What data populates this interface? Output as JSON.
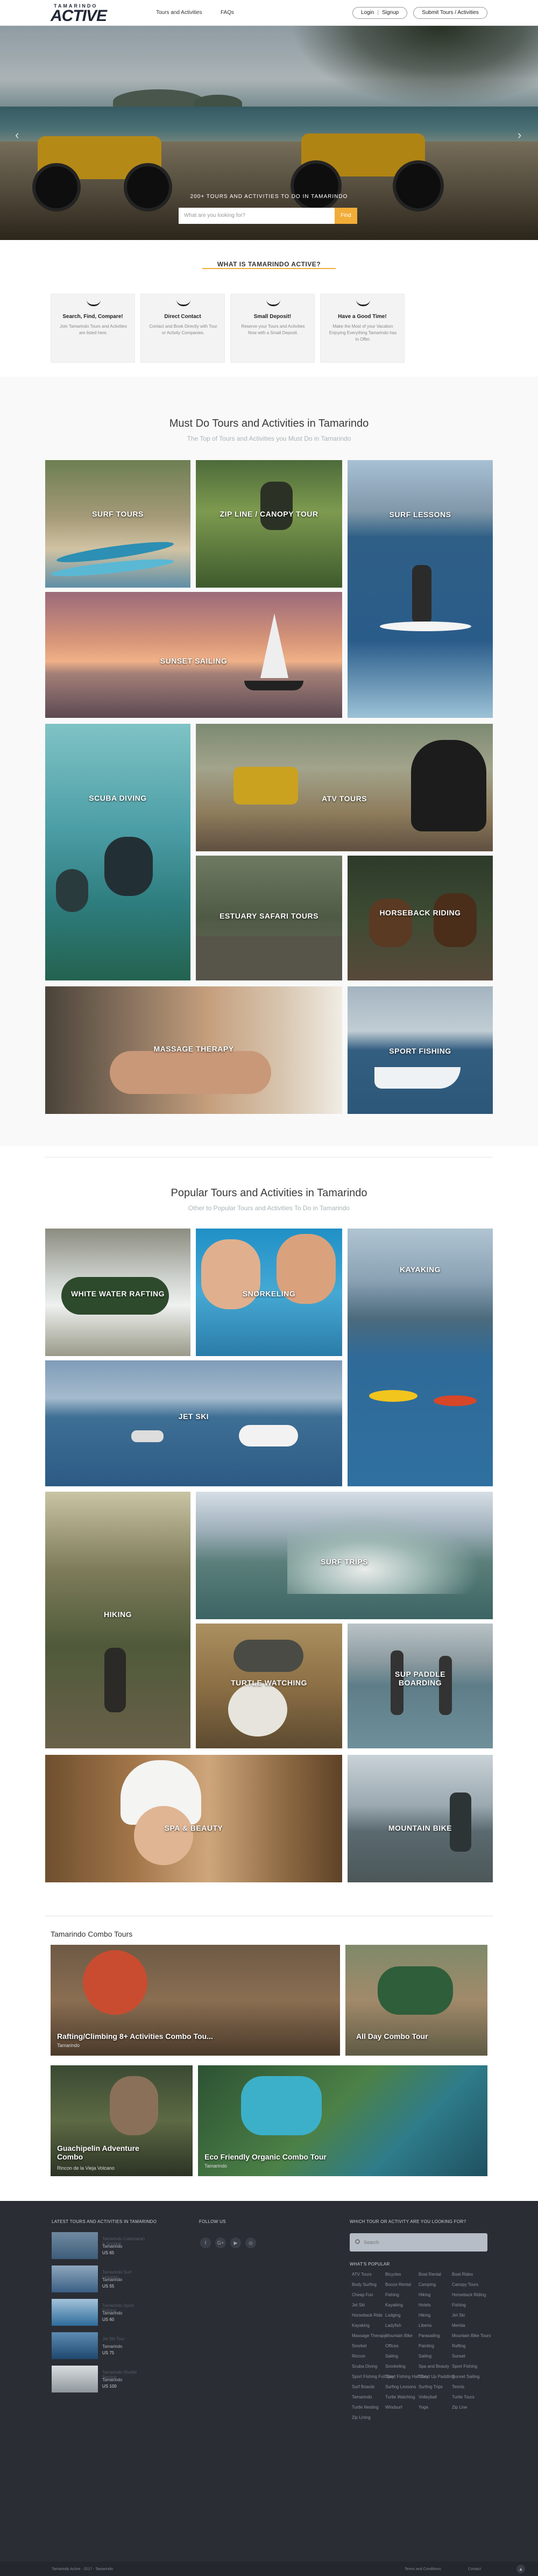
{
  "header": {
    "logo_small": "TAMARINDO",
    "logo_big": "ACTIVE",
    "nav": [
      "Tours and Activities",
      "FAQs"
    ],
    "login": "Login",
    "signup": "Signup",
    "submit": "Submit Tours / Activities"
  },
  "hero": {
    "title": "200+ TOURS AND ACTIVITIES TO DO IN TAMARINDO",
    "search_placeholder": "What are you looking for?",
    "search_button": "Find",
    "prev_icon": "‹",
    "next_icon": "›"
  },
  "whatis": {
    "heading": "WHAT IS TAMARINDO ACTIVE?",
    "features": [
      {
        "title": "Search, Find, Compare!",
        "text": "Join Tamarindo Tours and Activities are listed here.",
        "icon": "search-icon"
      },
      {
        "title": "Direct Contact",
        "text": "Contact and Book Directly with Tour or Activity Companies.",
        "icon": "contact-icon"
      },
      {
        "title": "Small Deposit!",
        "text": "Reserve your Tours and Activities Now with a Small Deposit.",
        "icon": "deposit-icon"
      },
      {
        "title": "Have a Good Time!",
        "text": "Make the Most of your Vacation Enjoying Everything Tamarindo has to Offer.",
        "icon": "smile-icon"
      }
    ]
  },
  "must_do": {
    "title": "Must Do Tours and Activities in Tamarindo",
    "subtitle": "The Top of Tours and Activities you Must Do in Tamarindo",
    "tiles": [
      "SURF TOURS",
      "ZIP LINE / CANOPY TOUR",
      "SURF LESSONS",
      "SUNSET SAILING",
      "SCUBA DIVING",
      "ATV TOURS",
      "ESTUARY SAFARI TOURS",
      "HORSEBACK RIDING",
      "MASSAGE THERAPY",
      "SPORT FISHING"
    ]
  },
  "popular": {
    "title": "Popular Tours and Activities in Tamarindo",
    "subtitle": "Other to Popular Tours and Activities To Do in Tamarindo",
    "tiles": [
      "WHITE WATER RAFTING",
      "SNORKELING",
      "KAYAKING",
      "JET SKI",
      "HIKING",
      "SURF TRIPS",
      "TURTLE WATCHING",
      "SUP PADDLE BOARDING",
      "SPA & BEAUTY",
      "MOUNTAIN BIKE"
    ]
  },
  "combos": {
    "title": "Tamarindo Combo Tours",
    "items": [
      {
        "title": "Rafting/Climbing 8+ Activities Combo Tou...",
        "location": "Tamarindo"
      },
      {
        "title": "All Day Combo Tour",
        "location": ""
      },
      {
        "title": "Guachipelin Adventure Combo",
        "location": "Rincon de la Vieja Volcano"
      },
      {
        "title": "Eco Friendly Organic Combo Tour",
        "location": "Tamarindo"
      }
    ]
  },
  "footer": {
    "latest_heading": "LATEST TOURS AND ACTIVITIES IN TAMARINDO",
    "posts": [
      {
        "title": "Tamarindo Catamaran & Snorkel",
        "location": "Tamarindo",
        "price": "US 65"
      },
      {
        "title": "Tamarindo Surf Lessons",
        "location": "Tamarindo",
        "price": "US 55"
      },
      {
        "title": "Tamarindo Sport Fishing",
        "location": "Tamarindo",
        "price": "US 60"
      },
      {
        "title": "Jet Ski Tour",
        "location": "Tamarindo",
        "price": "US 75"
      },
      {
        "title": "Tamarindo Shuttle Service",
        "location": "Tamarindo",
        "price": "US 100"
      }
    ],
    "follow_heading": "FOLLOW US",
    "social": [
      "f",
      "G+",
      "▶",
      "◎"
    ],
    "search_heading": "WHICH TOUR OR ACTIVITY ARE YOU LOOKING FOR?",
    "search_placeholder": "Search",
    "popular_heading": "WHAT'S POPULAR",
    "tags": [
      "ATV Tours",
      "Bicycles",
      "Boat Rental",
      "Boat Rides",
      "Body Surfing",
      "Booze Rental",
      "Camping",
      "Canopy Tours",
      "Cheap Fun",
      "Fishing",
      "Hiking",
      "Horseback Riding",
      "Jet Ski",
      "Kayaking",
      "Hotels",
      "Fishing",
      "Horseback Ride",
      "Lodging",
      "Hiking",
      "Jet Ski",
      "Kayaking",
      "Ladyfish",
      "Liberia",
      "Merida",
      "Massage Therapy",
      "Mountain Bike",
      "Parasailing",
      "Mountain Bike Tours",
      "Snorkel",
      "Offices",
      "Painting",
      "Rafting",
      "Rincon",
      "Sailing",
      "Sailing",
      "Sunset",
      "Scuba Diving",
      "Snorkeling",
      "Spa and Beauty",
      "Sport Fishing",
      "Sport Fishing Full Day",
      "Sport Fishing Half Day",
      "Stand Up Paddling",
      "Sunset Sailing",
      "Surf Boards",
      "Surfing Lessons",
      "Surfing Trips",
      "Tennis",
      "Tamarindo",
      "Turtle Watching",
      "Volleyball",
      "Turtle Tours",
      "Turtle Nesting",
      "Windsurf",
      "Yoga",
      "Zip Line",
      "Zip Lining"
    ]
  },
  "bottom": {
    "left": "Tamarindo Active - 2017 - Tamarindo",
    "right_a": "Terms and Conditions",
    "right_b": "Contact"
  },
  "colors": {
    "accent": "#f1ad38",
    "footer_bg": "#2a2d34"
  }
}
